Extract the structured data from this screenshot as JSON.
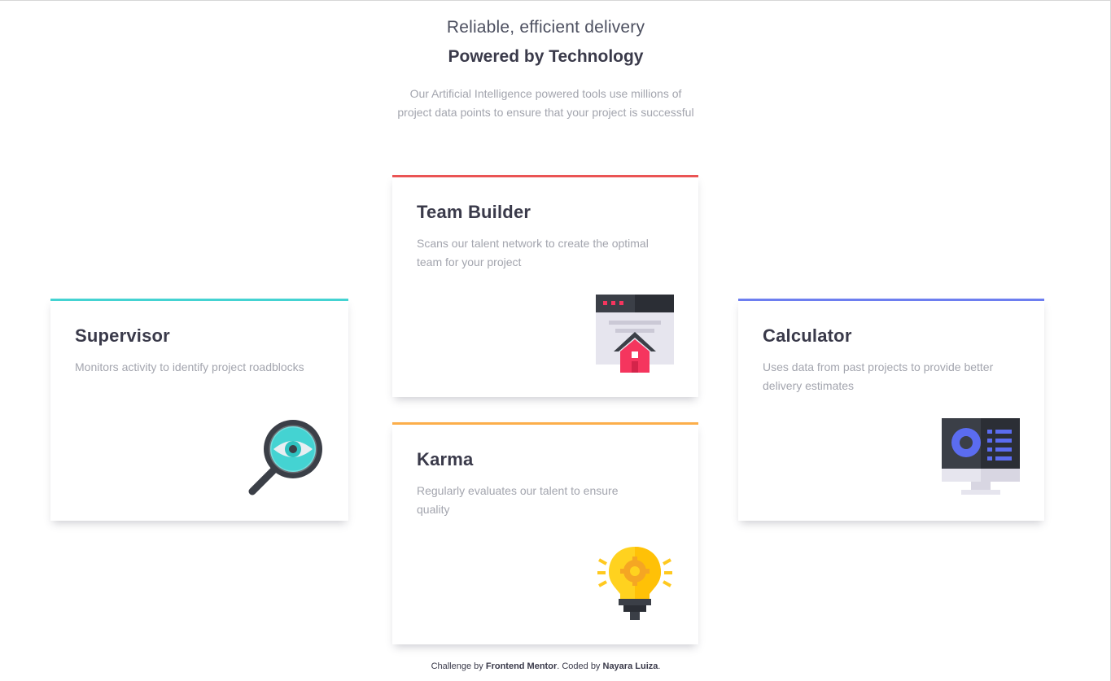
{
  "header": {
    "subtitle": "Reliable, efficient delivery",
    "title": "Powered by Technology",
    "intro": "Our Artificial Intelligence powered tools use millions of project data points to ensure that your project is successful"
  },
  "cards": [
    {
      "id": "supervisor",
      "title": "Supervisor",
      "description": "Monitors activity to identify project roadblocks",
      "icon": "magnifier-eye-icon",
      "accent": "#44d3d2"
    },
    {
      "id": "team",
      "title": "Team Builder",
      "description": "Scans our talent network to create the optimal team for your project",
      "icon": "browser-home-icon",
      "accent": "#ea5454"
    },
    {
      "id": "karma",
      "title": "Karma",
      "description": "Regularly evaluates our talent to ensure quality",
      "icon": "lightbulb-gear-icon",
      "accent": "#fcae4a"
    },
    {
      "id": "calculator",
      "title": "Calculator",
      "description": "Uses data from past projects to provide better delivery estimates",
      "icon": "monitor-chart-icon",
      "accent": "#6d7ef0"
    }
  ],
  "footer": {
    "challenge_prefix": "Challenge by",
    "challenge_link": "Frontend Mentor",
    "coded_prefix": ". Coded by",
    "coded_name": "Nayara Luiza",
    "suffix": "."
  }
}
